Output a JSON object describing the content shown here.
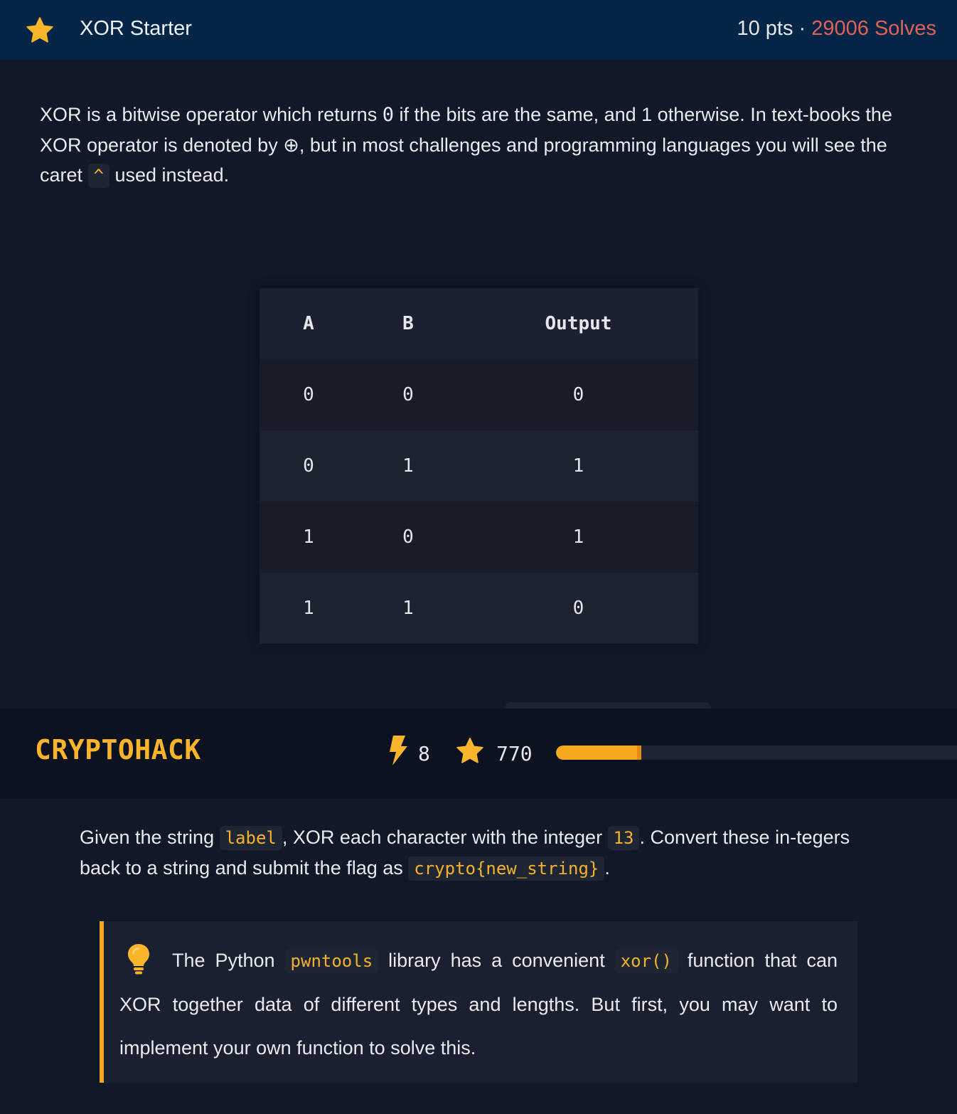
{
  "header": {
    "title": "XOR Starter",
    "points": "10 pts",
    "separator": " · ",
    "solves": "29006 Solves",
    "star_icon": "star-icon",
    "accent_color": "#fbb52b",
    "solves_color": "#e0625a"
  },
  "intro": {
    "part1": "XOR is a bitwise operator which returns ",
    "zero": "0",
    "part2": " if the bits are the same, and 1 otherwise. In text-books the XOR operator is denoted by ⊕, but in most challenges and programming languages you will see the caret ",
    "caret": "^",
    "part3": " used instead."
  },
  "truth_table": {
    "headers": [
      "A",
      "B",
      "Output"
    ],
    "rows": [
      [
        "0",
        "0",
        "0"
      ],
      [
        "0",
        "1",
        "1"
      ],
      [
        "1",
        "0",
        "1"
      ],
      [
        "1",
        "1",
        "0"
      ]
    ]
  },
  "navbar": {
    "brand": "CRYPTOHACK",
    "streak": "8",
    "score": "770",
    "progress_fraction": 0.21,
    "bolt_icon": "lightning-bolt-icon",
    "star_icon": "star-icon"
  },
  "task": {
    "part1": "Given the string ",
    "label_code": "label",
    "part2": ", XOR each character with the integer ",
    "int_code": "13",
    "part3": ". Convert these in-tegers back to a string and submit the flag as ",
    "flag_code": "crypto{new_string}",
    "part4": "."
  },
  "hint": {
    "icon": "lightbulb-icon",
    "part1": "The Python ",
    "lib_code": "pwntools",
    "part2": " library has a convenient ",
    "func_code": "xor()",
    "part3": " function that can XOR together data of different types and lengths. But first, you may want to implement your own function to solve this."
  }
}
